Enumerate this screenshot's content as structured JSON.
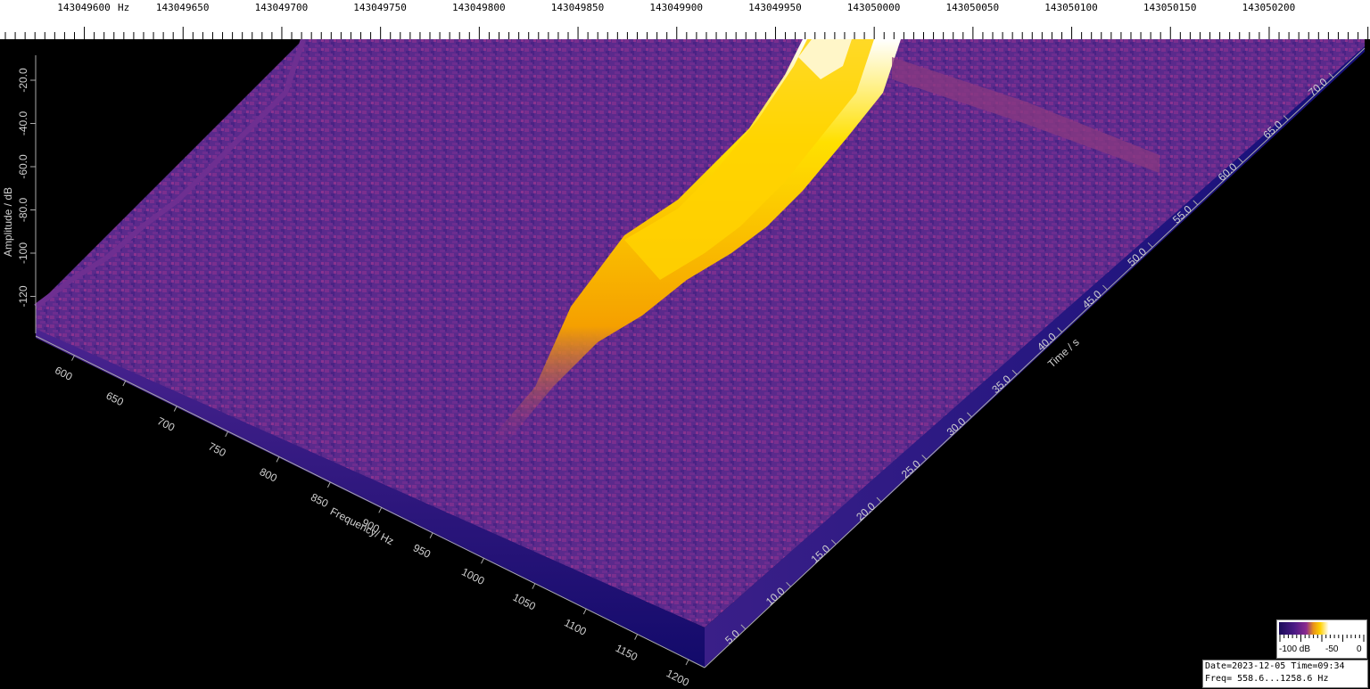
{
  "top_ruler": {
    "unit": "Hz",
    "labels": [
      "143049600",
      "143049650",
      "143049700",
      "143049750",
      "143049800",
      "143049850",
      "143049900",
      "143049950",
      "143050000",
      "143050050",
      "143050100",
      "143050150",
      "143050200"
    ]
  },
  "amplitude_axis": {
    "title": "Amplitude / dB",
    "ticks": [
      "-20.0",
      "-40.0",
      "-60.0",
      "-80.0",
      "-100",
      "-120"
    ]
  },
  "frequency_axis": {
    "title": "Frequency/ Hz",
    "ticks": [
      "600",
      "650",
      "700",
      "750",
      "800",
      "850",
      "900",
      "950",
      "1000",
      "1050",
      "1100",
      "1150",
      "1200"
    ]
  },
  "time_axis": {
    "title": "Time / s",
    "ticks": [
      "5.0",
      "10.0",
      "15.0",
      "20.0",
      "25.0",
      "30.0",
      "35.0",
      "40.0",
      "45.0",
      "50.0",
      "55.0",
      "60.0",
      "65.0",
      "70.0"
    ]
  },
  "legend": {
    "labels": [
      "-100 dB",
      "-50",
      "0"
    ]
  },
  "info": {
    "line1": "Date=2023-12-05 Time=09:34",
    "line2": "Freq= 558.6...1258.6 Hz"
  },
  "colors": {
    "background": "#000000",
    "surface_low": "#3a1d7a",
    "surface_mid": "#6b2d8f",
    "signal": "#ffc400",
    "signal_peak": "#ffffff",
    "front_edge": "#1d1370"
  }
}
